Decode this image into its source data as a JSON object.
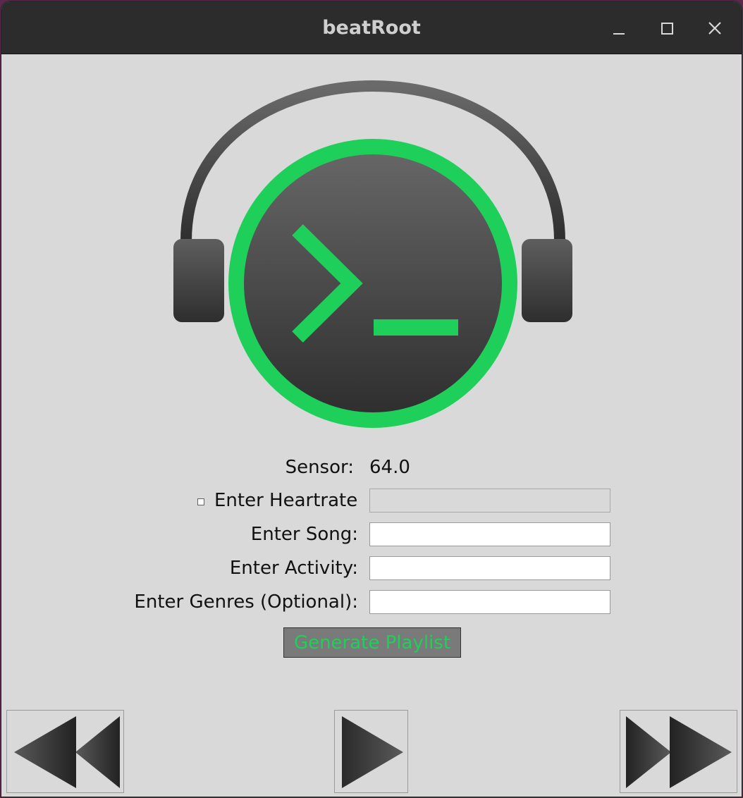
{
  "window": {
    "title": "beatRoot"
  },
  "form": {
    "sensor_label": "Sensor:",
    "sensor_value": "64.0",
    "heartrate_label": "Enter Heartrate",
    "heartrate_checked": false,
    "heartrate_value": "",
    "song_label": "Enter Song:",
    "song_value": "",
    "activity_label": "Enter Activity:",
    "activity_value": "",
    "genres_label": "Enter Genres (Optional):",
    "genres_value": "",
    "generate_label": "Generate Playlist"
  },
  "icons": {
    "logo": "headphones-terminal-logo",
    "rewind": "rewind-icon",
    "play": "play-icon",
    "fast_forward": "fast-forward-icon",
    "minimize": "minimize-icon",
    "maximize": "maximize-icon",
    "close": "close-icon"
  },
  "colors": {
    "accent_green": "#1ed05a",
    "titlebar": "#2c2c2c",
    "window_bg": "#d9d9d9"
  }
}
